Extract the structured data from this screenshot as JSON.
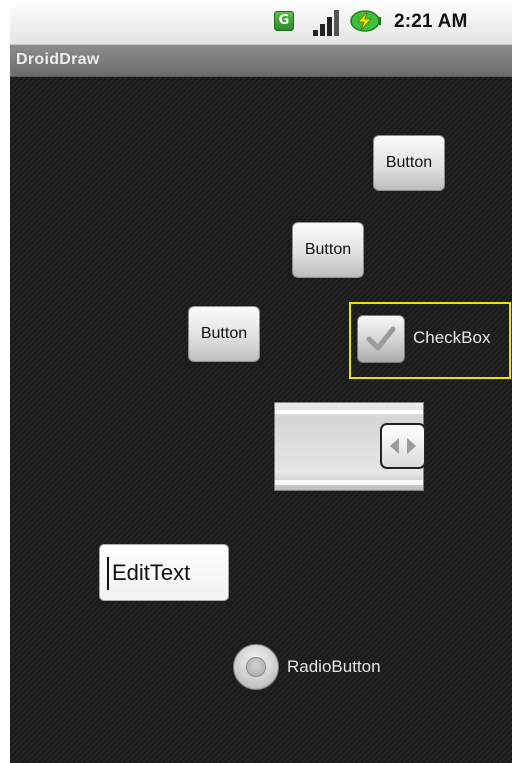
{
  "status_bar": {
    "carrier_badge": "G",
    "time": "2:21 AM",
    "icons": [
      "carrier-g-icon",
      "signal-bars-icon",
      "battery-charging-icon"
    ],
    "colors": {
      "carrier_green": "#3fa335",
      "battery_green": "#3ec13a",
      "bolt_yellow": "#f2e600"
    }
  },
  "app": {
    "title": "DroidDraw"
  },
  "widgets": {
    "button_1": {
      "label": "Button"
    },
    "button_2": {
      "label": "Button"
    },
    "button_3": {
      "label": "Button"
    },
    "checkbox": {
      "label": "CheckBox",
      "checked": true,
      "selection_outline_color": "#e6e600"
    },
    "slider": {
      "handle_icon": "left-right-arrows-icon"
    },
    "edit_text": {
      "value": "EditText"
    },
    "radio_button": {
      "label": "RadioButton",
      "checked": false
    }
  }
}
